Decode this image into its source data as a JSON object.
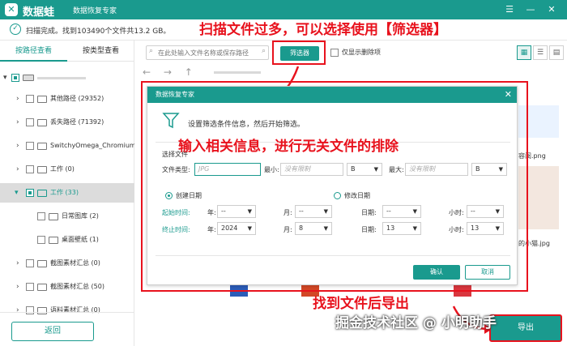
{
  "app": {
    "logo_glyph": "✕",
    "name": "数据蛙",
    "subtitle": "数据恢复专家"
  },
  "status": {
    "text": "扫描完成。找到103490个文件共13.2 GB。"
  },
  "annotations": {
    "filter_tip": "扫描文件过多，可以选择使用【筛选器】",
    "input_tip": "输入相关信息，进行无关文件的排除",
    "export_tip": "找到文件后导出",
    "watermark": "掘金技术社区 @ 小明助手"
  },
  "sidebar": {
    "tab_path": "按路径查看",
    "tab_type": "按类型查看",
    "items": [
      {
        "label": "其他路径 (29352)"
      },
      {
        "label": "丢失路径 (71392)"
      },
      {
        "label": "SwitchyOmega_Chromium"
      },
      {
        "label": "工作 (0)"
      },
      {
        "label": "工作 (33)"
      },
      {
        "label": "日常图库 (2)"
      },
      {
        "label": "桌面壁纸 (1)"
      },
      {
        "label": "截图素材汇总 (0)"
      },
      {
        "label": "截图素材汇总 (50)"
      },
      {
        "label": "语料素材汇总 (0)"
      }
    ],
    "back_label": "返回"
  },
  "toolbar": {
    "search_placeholder": "在此处输入文件名称或保存路径",
    "filter_label": "筛选器",
    "deleted_only_label": "仅显示删除项"
  },
  "files": {
    "name1": "容阅.png",
    "name2": "的小猫.jpg"
  },
  "dialog": {
    "title": "数据恢复专家",
    "info": "设置筛选条件信息，然后开始筛选。",
    "section": "选择文件",
    "file_type_label": "文件类型:",
    "file_type_placeholder": "JPG",
    "min_label": "最小:",
    "min_placeholder": "没有限制",
    "min_unit": "B",
    "max_label": "最大:",
    "max_placeholder": "没有限制",
    "max_unit": "B",
    "created_label": "创建日期",
    "modified_label": "修改日期",
    "start_label": "起始时间:",
    "end_label": "终止时间:",
    "year_label": "年:",
    "month_label": "月:",
    "day_label": "日期:",
    "hour_label": "小时:",
    "start_year": "--",
    "start_month": "--",
    "start_day": "--",
    "start_hour": "--",
    "end_year": "2024",
    "end_month": "8",
    "end_day": "13",
    "end_hour": "13",
    "ok_label": "确认",
    "cancel_label": "取消"
  },
  "export": {
    "label": "导出"
  },
  "colors": {
    "accent": "#1a9a8e",
    "annotation": "#e8121d"
  }
}
